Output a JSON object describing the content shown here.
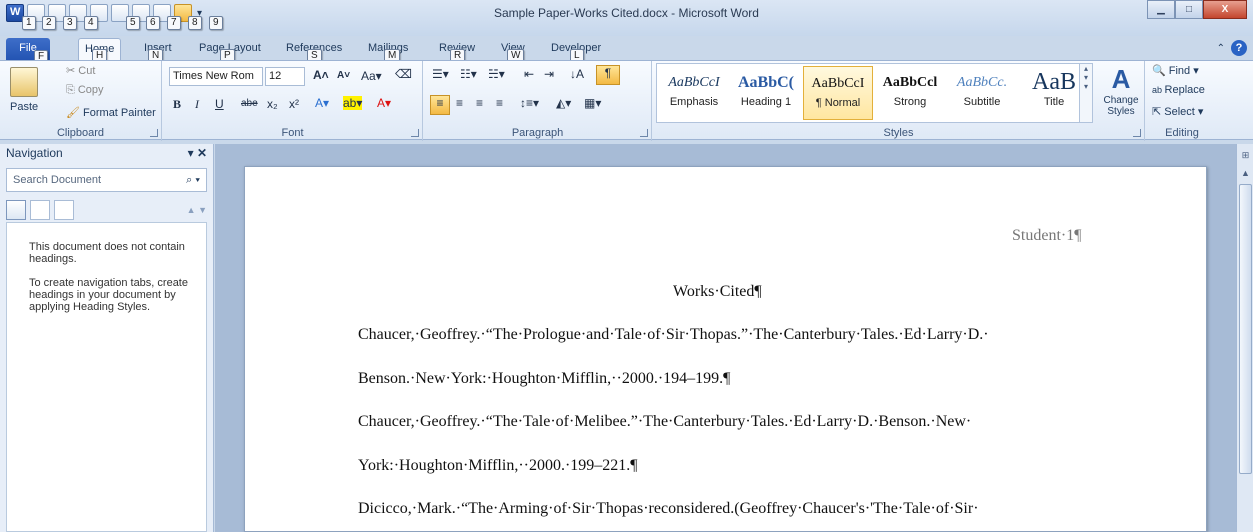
{
  "window": {
    "title": "Sample Paper-Works Cited.docx - Microsoft Word",
    "min_label": "▁",
    "max_label": "□",
    "close_label": "X"
  },
  "qat_keytips": [
    "1",
    "2",
    "3",
    "4",
    "5",
    "6",
    "7",
    "8",
    "9"
  ],
  "tabs": [
    {
      "label": "File",
      "keytip": "F"
    },
    {
      "label": "Home",
      "keytip": "H"
    },
    {
      "label": "Insert",
      "keytip": "N"
    },
    {
      "label": "Page Layout",
      "keytip": "P"
    },
    {
      "label": "References",
      "keytip": "S"
    },
    {
      "label": "Mailings",
      "keytip": "M"
    },
    {
      "label": "Review",
      "keytip": "R"
    },
    {
      "label": "View",
      "keytip": "W"
    },
    {
      "label": "Developer",
      "keytip": "L"
    }
  ],
  "clipboard": {
    "label": "Clipboard",
    "paste": "Paste",
    "cut": "Cut",
    "copy": "Copy",
    "format_painter": "Format Painter"
  },
  "font": {
    "label": "Font",
    "name": "Times New Rom",
    "size": "12",
    "bold": "B",
    "italic": "I",
    "underline": "U",
    "strike": "abe",
    "sub": "x₂",
    "sup": "x²"
  },
  "paragraph": {
    "label": "Paragraph"
  },
  "styles": {
    "label": "Styles",
    "items": [
      {
        "preview": "AaBbCcI",
        "name": "Emphasis"
      },
      {
        "preview": "AaBbC(",
        "name": "Heading 1"
      },
      {
        "preview": "AaBbCcI",
        "name": "¶ Normal"
      },
      {
        "preview": "AaBbCcl",
        "name": "Strong"
      },
      {
        "preview": "AaBbCc.",
        "name": "Subtitle"
      },
      {
        "preview": "AaB",
        "name": "Title"
      }
    ],
    "change_styles": "Change Styles"
  },
  "editing": {
    "label": "Editing",
    "find": "Find",
    "replace": "Replace",
    "select": "Select"
  },
  "navigation": {
    "title": "Navigation",
    "search_placeholder": "Search Document",
    "msg1": "This document does not contain headings.",
    "msg2": "To create navigation tabs, create headings in your document by applying Heading Styles."
  },
  "document": {
    "header": "Student·1¶",
    "heading": "Works·Cited¶",
    "lines": [
      "Chaucer,·Geoffrey.·“The·Prologue·and·Tale·of·Sir·Thopas.”·The·Canterbury·Tales.·Ed·Larry·D.·",
      "Benson.·New·York:·Houghton·Mifflin,··2000.·194–199.¶",
      "Chaucer,·Geoffrey.·“The·Tale·of·Melibee.”·The·Canterbury·Tales.·Ed·Larry·D.·Benson.·New·",
      "York:·Houghton·Mifflin,··2000.·199–221.¶",
      "Dicicco,·Mark.·“The·Arming·of·Sir·Thopas·reconsidered.(Geoffrey·Chaucer's·'The·Tale·of·Sir·"
    ]
  }
}
